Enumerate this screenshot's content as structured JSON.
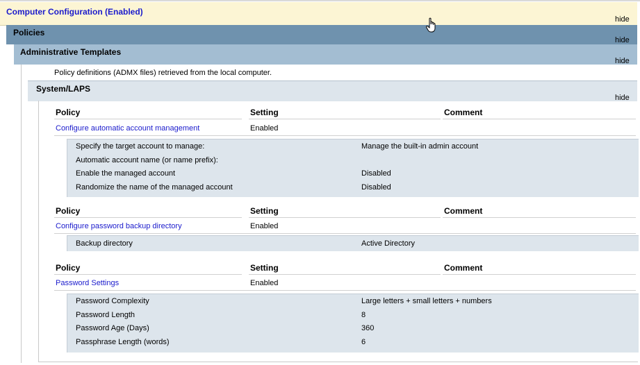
{
  "computer_configuration": {
    "title": "Computer Configuration (Enabled)",
    "hide_label": "hide"
  },
  "policies": {
    "title": "Policies",
    "hide_label": "hide"
  },
  "admin_templates": {
    "title": "Administrative Templates",
    "hide_label": "hide",
    "description": "Policy definitions (ADMX files) retrieved from the local computer."
  },
  "system_laps": {
    "title": "System/LAPS",
    "hide_label": "hide",
    "columns": {
      "policy": "Policy",
      "setting": "Setting",
      "comment": "Comment"
    },
    "policies": [
      {
        "name": "Configure automatic account management",
        "setting": "Enabled",
        "details": [
          {
            "label": "Specify the target account to manage:",
            "value": "Manage the built-in admin account"
          },
          {
            "label": "Automatic account name (or name prefix):",
            "value": ""
          },
          {
            "label": "Enable the managed account",
            "value": "Disabled"
          },
          {
            "label": "Randomize the name of the managed account",
            "value": "Disabled"
          }
        ]
      },
      {
        "name": "Configure password backup directory",
        "setting": "Enabled",
        "details": [
          {
            "label": "Backup directory",
            "value": "Active Directory"
          }
        ]
      },
      {
        "name": "Password Settings",
        "setting": "Enabled",
        "details": [
          {
            "label": "Password Complexity",
            "value": "Large letters + small letters + numbers"
          },
          {
            "label": "Password Length",
            "value": "8"
          },
          {
            "label": "Password Age (Days)",
            "value": "360"
          },
          {
            "label": "Passphrase Length (words)",
            "value": "6"
          }
        ]
      }
    ]
  }
}
